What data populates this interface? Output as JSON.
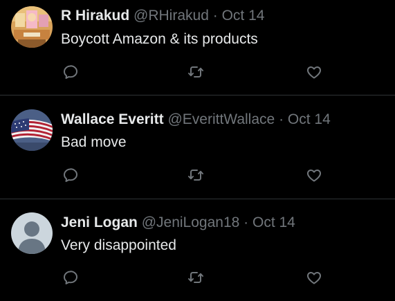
{
  "tweets": [
    {
      "display_name": "R Hirakud",
      "handle": "@RHirakud",
      "separator": "·",
      "date": "Oct 14",
      "text": "Boycott Amazon & its products",
      "avatar_icon": "collage-avatar"
    },
    {
      "display_name": "Wallace Everitt",
      "handle": "@EverittWallace",
      "separator": "·",
      "date": "Oct 14",
      "text": "Bad move",
      "avatar_icon": "us-flag-avatar"
    },
    {
      "display_name": "Jeni Logan",
      "handle": "@JeniLogan18",
      "separator": "·",
      "date": "Oct 14",
      "text": "Very disappointed",
      "avatar_icon": "default-profile-avatar"
    }
  ],
  "icons": {
    "reply": "reply-icon",
    "retweet": "retweet-icon",
    "like": "heart-icon"
  },
  "colors": {
    "background": "#000000",
    "primary_text": "#e7e9ea",
    "secondary_text": "#71767b",
    "divider": "#2f3336"
  }
}
